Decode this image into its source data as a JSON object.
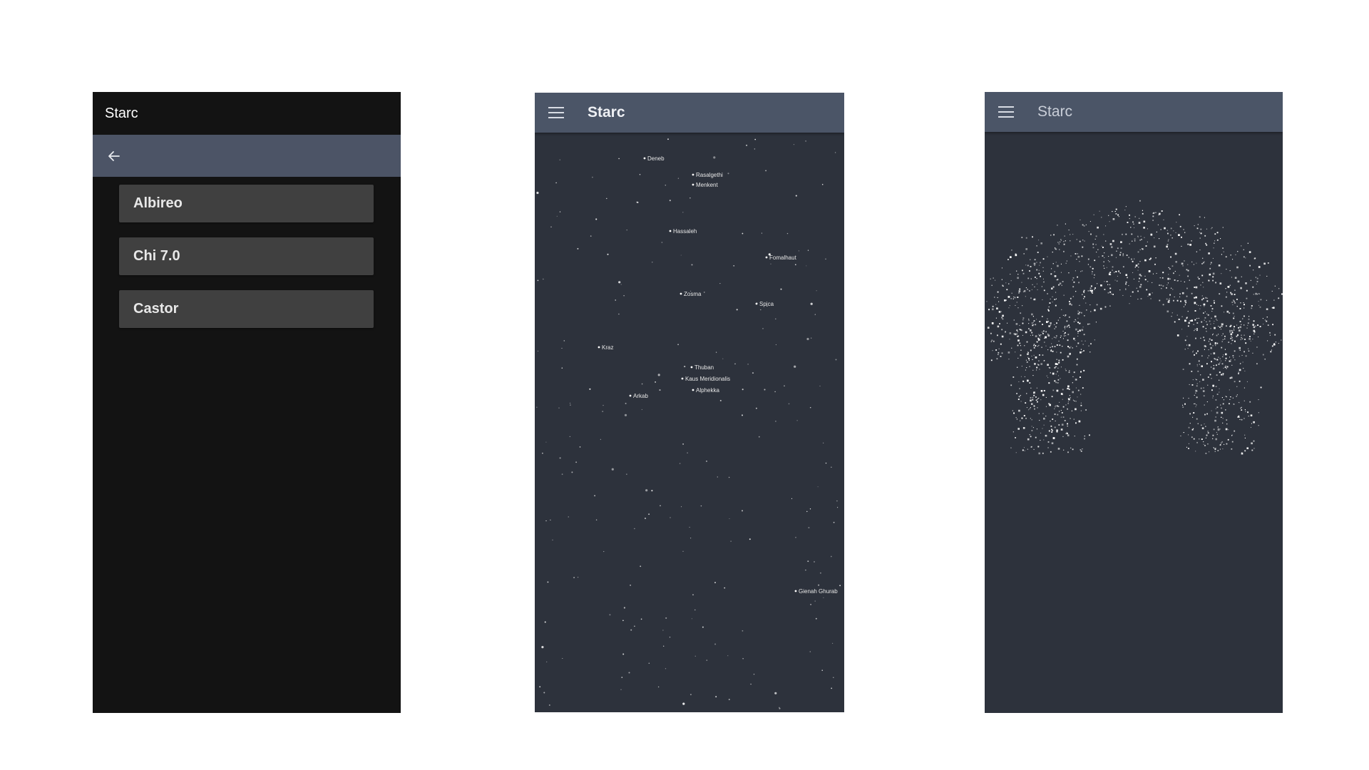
{
  "screen1": {
    "title": "Starc",
    "back_icon": "arrow-left-icon",
    "items": [
      {
        "label": "Albireo"
      },
      {
        "label": "Chi 7.0"
      },
      {
        "label": "Castor"
      }
    ]
  },
  "screen2": {
    "title": "Starc",
    "menu_icon": "hamburger-menu-icon",
    "labeled_stars": [
      {
        "name": "Deneb"
      },
      {
        "name": "Rasalgethi"
      },
      {
        "name": "Menkent"
      },
      {
        "name": "Hassaleh"
      },
      {
        "name": "Fomalhaut"
      },
      {
        "name": "Zosma"
      },
      {
        "name": "Spica"
      },
      {
        "name": "Kraz"
      },
      {
        "name": "Thuban"
      },
      {
        "name": "Kaus Meridionalis"
      },
      {
        "name": "Alphekka"
      },
      {
        "name": "Arkab"
      },
      {
        "name": "Gienah Ghurab"
      }
    ]
  },
  "screen3": {
    "title": "Starc",
    "menu_icon": "hamburger-menu-icon"
  },
  "colors": {
    "background": "#ffffff",
    "screen1_bg": "#131313",
    "toolbar": "#4c5466",
    "list_item": "#404040",
    "sky": "#2d323c",
    "appbar": "#4b5567",
    "star": "#ffffff"
  }
}
